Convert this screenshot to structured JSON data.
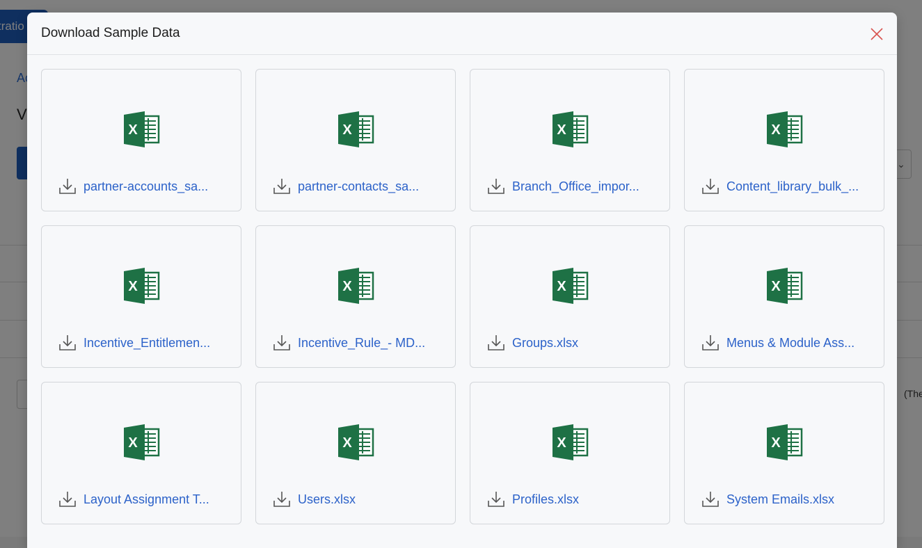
{
  "background": {
    "tab_text": "tratio",
    "breadcrumb": "Ac",
    "heading": "V",
    "select_caret": "⌄",
    "note": "(The"
  },
  "modal": {
    "title": "Download Sample Data",
    "close_icon": "close-icon",
    "files": [
      {
        "name": "partner-accounts_sa..."
      },
      {
        "name": "partner-contacts_sa..."
      },
      {
        "name": "Branch_Office_impor..."
      },
      {
        "name": "Content_library_bulk_..."
      },
      {
        "name": "Incentive_Entitlemen..."
      },
      {
        "name": "Incentive_Rule_- MD..."
      },
      {
        "name": "Groups.xlsx"
      },
      {
        "name": "Menus & Module Ass..."
      },
      {
        "name": "Layout Assignment T..."
      },
      {
        "name": "Users.xlsx"
      },
      {
        "name": "Profiles.xlsx"
      },
      {
        "name": "System Emails.xlsx"
      }
    ]
  },
  "colors": {
    "excel_green": "#1e7145",
    "link_blue": "#2c62c9",
    "close_red": "#d9534f"
  }
}
